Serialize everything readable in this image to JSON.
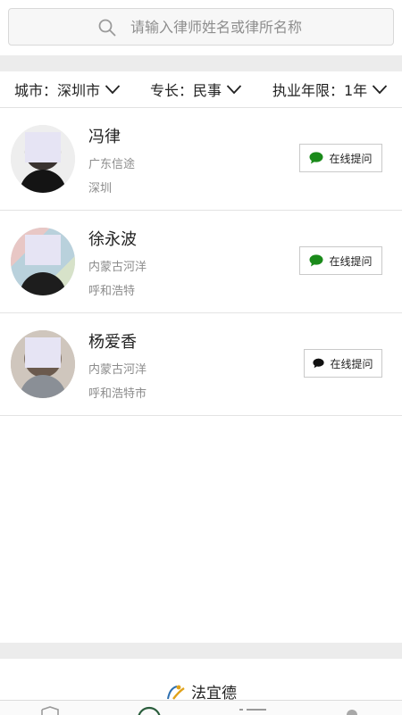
{
  "search": {
    "placeholder": "请输入律师姓名或律所名称"
  },
  "filters": [
    {
      "label": "城市：深圳市"
    },
    {
      "label": "专长：民事"
    },
    {
      "label": "执业年限：1年"
    }
  ],
  "lawyers": [
    {
      "name": "冯律",
      "firm": "广东信途",
      "city": "深圳",
      "ask_label": "在线提问",
      "ask_icon": "chat-bubble-icon",
      "icon_color": "#1a8a1a"
    },
    {
      "name": "徐永波",
      "firm": "内蒙古河洋",
      "city": "呼和浩特",
      "ask_label": "在线提问",
      "ask_icon": "chat-bubble-icon",
      "icon_color": "#1a8a1a"
    },
    {
      "name": "杨爱香",
      "firm": "内蒙古河洋",
      "city": "呼和浩特市",
      "ask_label": "在线提问",
      "ask_icon": "chat-bubble-icon",
      "icon_color": "#111111"
    }
  ],
  "footer": {
    "brand": "法宜德",
    "brand_icon": "logo-icon"
  },
  "tabbar": {
    "icons": [
      "shield-icon",
      "circle-icon",
      "list-icon",
      "person-icon"
    ]
  },
  "colors": {
    "accent_green": "#1a8a1a",
    "band_gray": "#ececec"
  }
}
